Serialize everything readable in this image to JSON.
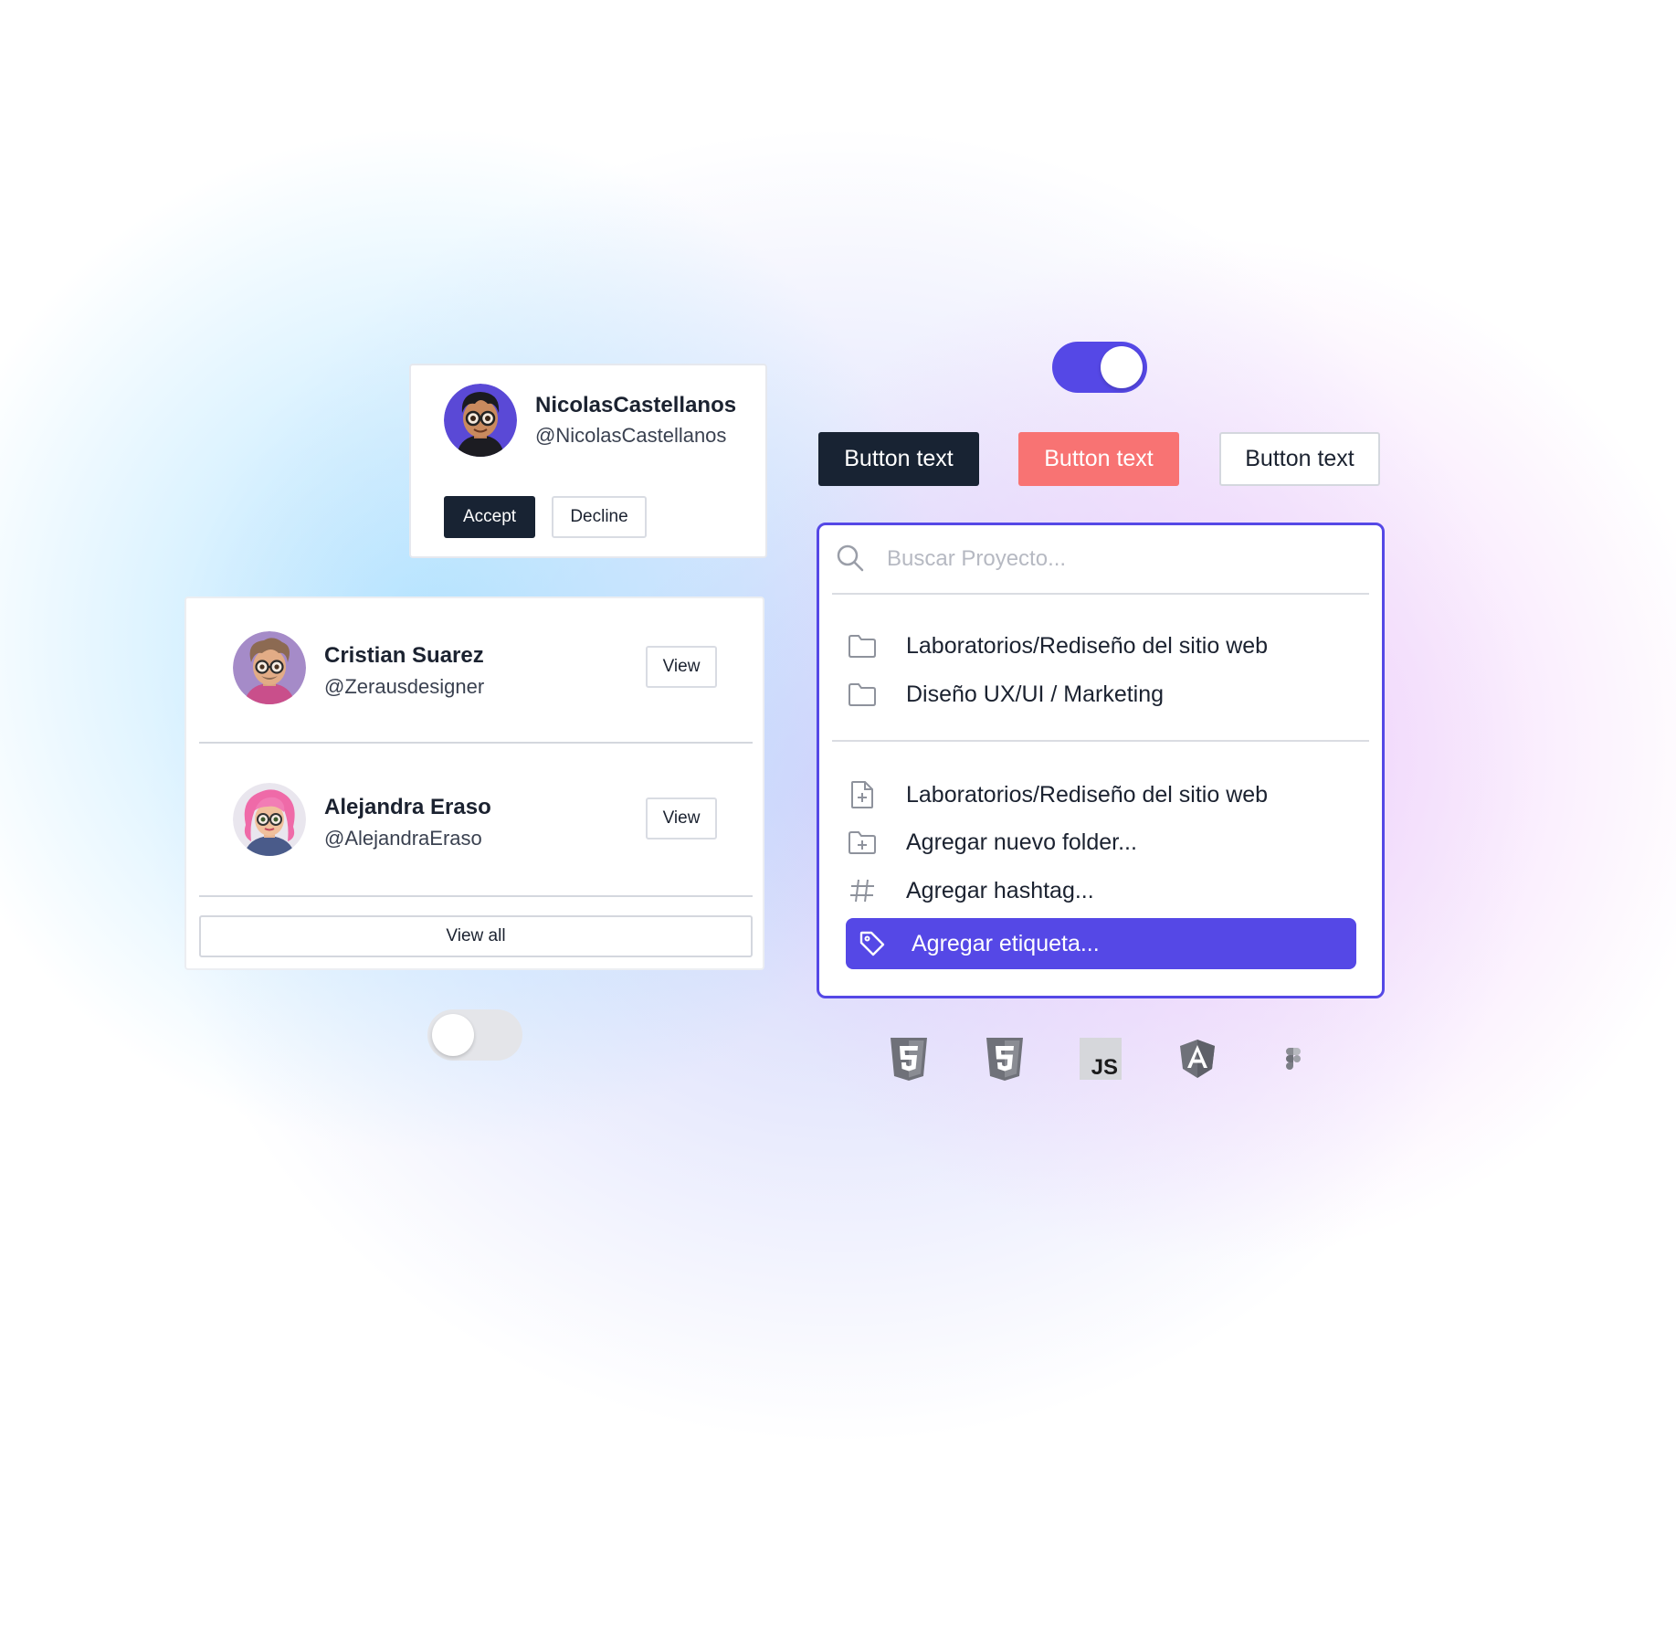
{
  "request_card": {
    "name": "NicolasCastellanos",
    "handle": "@NicolasCastellanos",
    "accept_label": "Accept",
    "decline_label": "Decline"
  },
  "user_list": {
    "users": [
      {
        "name": "Cristian Suarez",
        "handle": "@Zerausdesigner",
        "view_label": "View"
      },
      {
        "name": "Alejandra Eraso",
        "handle": "@AlejandraEraso",
        "view_label": "View"
      }
    ],
    "view_all_label": "View all"
  },
  "toggles": {
    "top_on": true,
    "bottom_on": false
  },
  "buttons": {
    "dark_label": "Button text",
    "coral_label": "Button text",
    "outline_label": "Button text"
  },
  "palette": {
    "search_placeholder": "Buscar Proyecto...",
    "folders": [
      "Laboratorios/Rediseño del sitio web",
      "Diseño UX/UI / Marketing"
    ],
    "actions": [
      "Laboratorios/Rediseño del sitio web",
      "Agregar nuevo folder...",
      "Agregar  hashtag..."
    ],
    "active_action": "Agregar etiqueta..."
  },
  "tech_icons": [
    "html5-icon",
    "css3-icon",
    "javascript-icon",
    "angular-icon",
    "figma-icon"
  ],
  "colors": {
    "accent": "#5548e6",
    "dark": "#182333",
    "coral": "#f87373"
  }
}
